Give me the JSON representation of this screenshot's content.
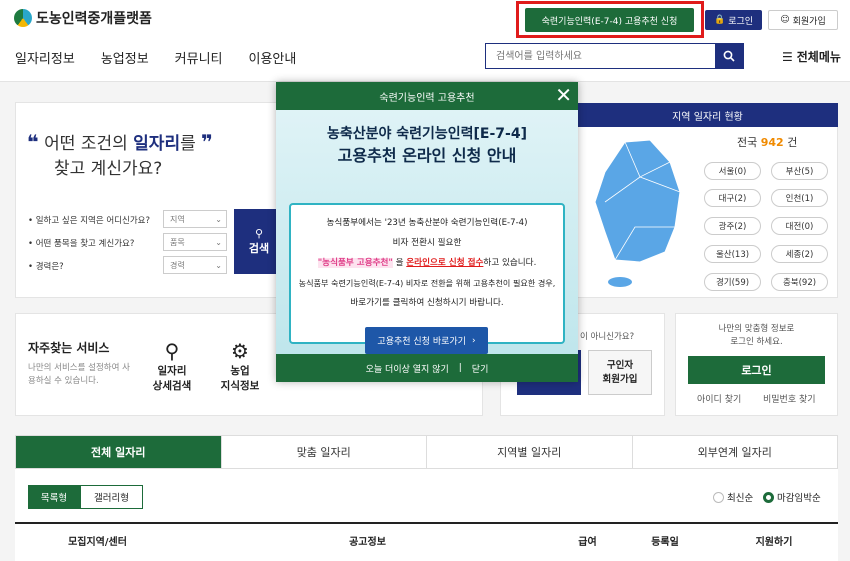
{
  "header": {
    "logo_text": "도농인력중개플랫폼",
    "apply_button": "숙련기능인력(E-7-4) 고용추천 신청",
    "login_button": "로그인",
    "join_button": "회원가입",
    "nav": [
      "일자리정보",
      "농업정보",
      "커뮤니티",
      "이용안내"
    ],
    "search_placeholder": "검색어를 입력하세요",
    "all_menu": "전체메뉴"
  },
  "search_panel": {
    "quote_line1_pre": "어떤 조건의 ",
    "quote_line1_bold": "일자리",
    "quote_line1_post": "를",
    "quote_line2": "찾고 계신가요?",
    "filters": [
      {
        "label": "• 일하고 싶은 지역은 어디신가요?",
        "select": "지역"
      },
      {
        "label": "• 어떤 품목을 찾고 계신가요?",
        "select": "품목"
      },
      {
        "label": "• 경력은?",
        "select": "경력"
      }
    ],
    "search_button": "검색"
  },
  "region": {
    "title": "지역 일자리 현황",
    "total_prefix": "전국",
    "total_count": "942",
    "total_suffix": "건",
    "chips": [
      "서울(0)",
      "부산(5)",
      "대구(2)",
      "인천(1)",
      "광주(2)",
      "대전(0)",
      "울산(13)",
      "세종(2)",
      "경기(59)",
      "충북(92)"
    ]
  },
  "services": {
    "title": "자주찾는 서비스",
    "desc": "나만의 서비스를 설정하여 사용하실 수 있습니다.",
    "items": [
      {
        "label1": "일자리",
        "label2": "상세검색"
      },
      {
        "label1": "농업",
        "label2": "지식정보"
      }
    ],
    "q_text": "이 아니신가요?",
    "employer_join1": "구인자",
    "employer_join2": "회원가입"
  },
  "login_panel": {
    "desc1": "나만의 맞춤형 정보로",
    "desc2": "로그인 하세요.",
    "login_button": "로그인",
    "find_id": "아이디 찾기",
    "find_pw": "비밀번호 찾기"
  },
  "tabs": [
    "전체 일자리",
    "맞춤 일자리",
    "지역별 일자리",
    "외부연계 일자리"
  ],
  "view_toggle": [
    "목록형",
    "갤러리형"
  ],
  "sort": {
    "latest": "최신순",
    "deadline": "마감임박순"
  },
  "table_headers": [
    "모집지역/센터",
    "공고정보",
    "급여",
    "등록일",
    "지원하기"
  ],
  "modal": {
    "title": "숙련기능인력 고용추천",
    "headline1": "농축산분야 숙련기능인력[E-7-4]",
    "headline2": "고용추천 온라인 신청 안내",
    "p1": "농식품부에서는 '23년 농축산분야 숙련기능인력(E-7-4)",
    "p2": "비자 전환시 필요한",
    "p3_pink": "\"농식품부 고용추천\"",
    "p3_mid": " 을 ",
    "p3_red": "온라인으로 신청 접수",
    "p3_end": "하고 있습니다.",
    "p4": "농식품부 숙련기능인력(E-7-4) 비자로 전환을 위해 고용추천이 필요한 경우,",
    "p5": "바로가기를 클릭하여 신청하시기 바랍니다.",
    "button": "고용추천 신청 바로가기",
    "footer_no_show": "오늘 더이상 열지 않기",
    "footer_sep": "|",
    "footer_close": "닫기"
  },
  "colors": {
    "navy": "#1e2f7e",
    "green": "#1d6b3a",
    "highlight": "#e01b1b",
    "pink": "#e0408a"
  }
}
